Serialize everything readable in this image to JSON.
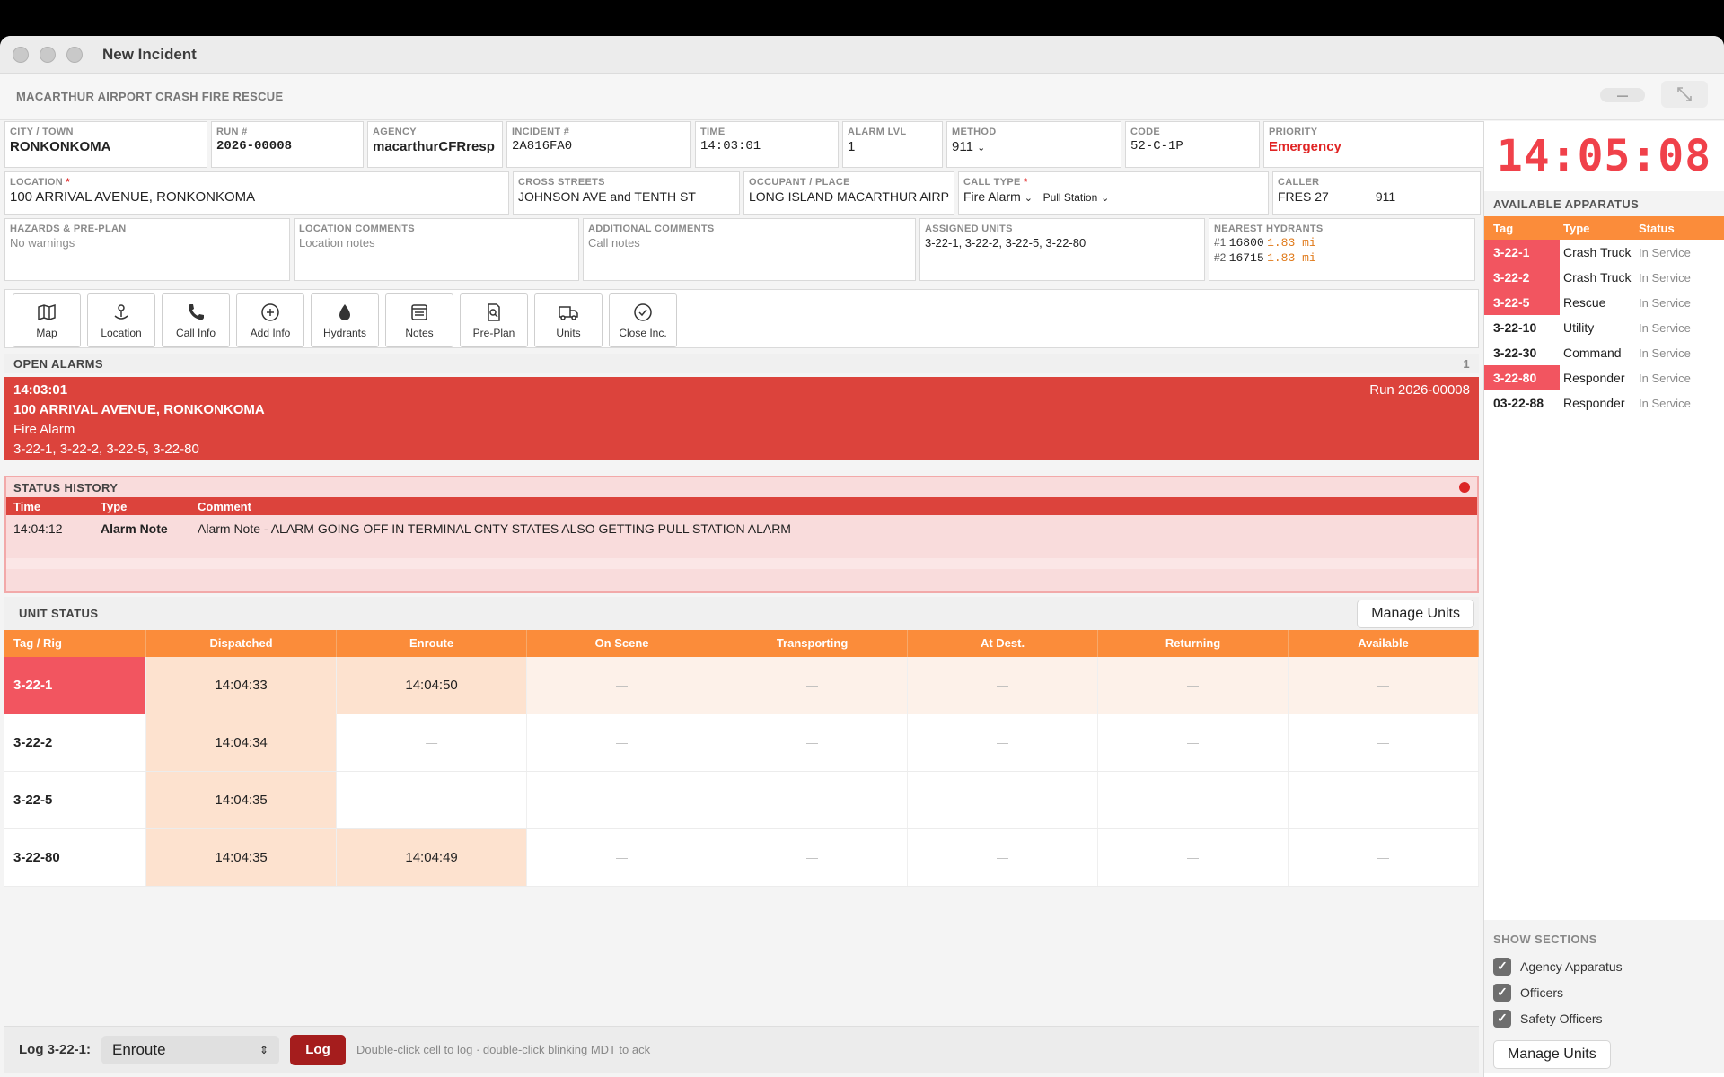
{
  "window": {
    "title": "New Incident"
  },
  "agency_bar": {
    "name": "MACARTHUR AIRPORT CRASH FIRE RESCUE",
    "min_label": "—"
  },
  "fields": {
    "city": {
      "label": "CITY / TOWN",
      "value": "RONKONKOMA"
    },
    "run": {
      "label": "RUN #",
      "value": "2026-00008"
    },
    "agency": {
      "label": "AGENCY",
      "value": "macarthurCFRresp"
    },
    "incident": {
      "label": "INCIDENT #",
      "value": "2A816FA0"
    },
    "time": {
      "label": "TIME",
      "value": "14:03:01"
    },
    "alarm_lvl": {
      "label": "ALARM LVL",
      "value": "1"
    },
    "method": {
      "label": "METHOD",
      "value": "911"
    },
    "code": {
      "label": "CODE",
      "value": "52-C-1P"
    },
    "priority": {
      "label": "PRIORITY",
      "value": "Emergency"
    },
    "location": {
      "label": "LOCATION",
      "value": "100 ARRIVAL AVENUE, RONKONKOMA"
    },
    "cross_streets": {
      "label": "CROSS STREETS",
      "value": "JOHNSON AVE and TENTH ST"
    },
    "occupant": {
      "label": "OCCUPANT / PLACE",
      "value": "LONG ISLAND MACARTHUR AIRPORT"
    },
    "call_type": {
      "label": "CALL TYPE",
      "value": "Fire Alarm",
      "subtype": "Pull Station"
    },
    "caller": {
      "label": "CALLER",
      "value": "FRES 27",
      "number": "911"
    },
    "hazards": {
      "label": "HAZARDS & PRE-PLAN",
      "value": "No warnings"
    },
    "location_comments": {
      "label": "LOCATION COMMENTS",
      "placeholder": "Location notes"
    },
    "additional_comments": {
      "label": "ADDITIONAL COMMENTS",
      "placeholder": "Call notes"
    },
    "assigned_units": {
      "label": "ASSIGNED UNITS",
      "value": "3-22-1, 3-22-2, 3-22-5, 3-22-80"
    },
    "nearest_hydrants": {
      "label": "NEAREST HYDRANTS",
      "items": [
        {
          "rank": "#1",
          "id": "16800",
          "dist": "1.83 mi"
        },
        {
          "rank": "#2",
          "id": "16715",
          "dist": "1.83 mi"
        }
      ]
    }
  },
  "toolbar": [
    {
      "label": "Map",
      "icon": "map-icon"
    },
    {
      "label": "Location",
      "icon": "location-pin-icon"
    },
    {
      "label": "Call Info",
      "icon": "phone-icon"
    },
    {
      "label": "Add Info",
      "icon": "plus-circle-icon"
    },
    {
      "label": "Hydrants",
      "icon": "drop-icon"
    },
    {
      "label": "Notes",
      "icon": "notes-icon"
    },
    {
      "label": "Pre-Plan",
      "icon": "document-search-icon"
    },
    {
      "label": "Units",
      "icon": "truck-icon"
    },
    {
      "label": "Close Inc.",
      "icon": "check-circle-icon"
    }
  ],
  "open_alarms": {
    "title": "OPEN ALARMS",
    "count": "1",
    "alarm": {
      "time": "14:03:01",
      "address": "100 ARRIVAL AVENUE, RONKONKOMA",
      "type": "Fire Alarm",
      "units": "3-22-1, 3-22-2, 3-22-5, 3-22-80",
      "run": "Run 2026-00008"
    }
  },
  "status_history": {
    "title": "STATUS HISTORY",
    "columns": [
      "Time",
      "Type",
      "Comment"
    ],
    "rows": [
      {
        "time": "14:04:12",
        "type": "Alarm Note",
        "comment": "Alarm Note - ALARM GOING OFF IN TERMINAL CNTY STATES ALSO GETTING PULL STATION ALARM"
      }
    ]
  },
  "unit_status": {
    "title": "UNIT STATUS",
    "manage_label": "Manage Units",
    "columns": [
      "Tag / Rig",
      "Dispatched",
      "Enroute",
      "On Scene",
      "Transporting",
      "At Dest.",
      "Returning",
      "Available"
    ],
    "empty": "—",
    "rows": [
      {
        "tag": "3-22-1",
        "selected": true,
        "cells": [
          "14:04:33",
          "14:04:50",
          "",
          "",
          "",
          "",
          ""
        ]
      },
      {
        "tag": "3-22-2",
        "selected": false,
        "cells": [
          "14:04:34",
          "",
          "",
          "",
          "",
          "",
          ""
        ]
      },
      {
        "tag": "3-22-5",
        "selected": false,
        "cells": [
          "14:04:35",
          "",
          "",
          "",
          "",
          "",
          ""
        ]
      },
      {
        "tag": "3-22-80",
        "selected": false,
        "cells": [
          "14:04:35",
          "14:04:49",
          "",
          "",
          "",
          "",
          ""
        ]
      }
    ]
  },
  "footer": {
    "log_label": "Log 3-22-1:",
    "select_value": "Enroute",
    "log_button": "Log",
    "hint": "Double-click cell to log · double-click blinking MDT to ack"
  },
  "clock": "14:05:08",
  "apparatus": {
    "title": "AVAILABLE APPARATUS",
    "columns": [
      "Tag",
      "Type",
      "Status"
    ],
    "rows": [
      {
        "tag": "3-22-1",
        "type": "Crash Truck",
        "status": "In Service",
        "assigned": true
      },
      {
        "tag": "3-22-2",
        "type": "Crash Truck",
        "status": "In Service",
        "assigned": true
      },
      {
        "tag": "3-22-5",
        "type": "Rescue",
        "status": "In Service",
        "assigned": true
      },
      {
        "tag": "3-22-10",
        "type": "Utility",
        "status": "In Service",
        "assigned": false
      },
      {
        "tag": "3-22-30",
        "type": "Command",
        "status": "In Service",
        "assigned": false
      },
      {
        "tag": "3-22-80",
        "type": "Responder",
        "status": "In Service",
        "assigned": true
      },
      {
        "tag": "03-22-88",
        "type": "Responder",
        "status": "In Service",
        "assigned": false
      }
    ]
  },
  "show_sections": {
    "title": "SHOW SECTIONS",
    "items": [
      {
        "label": "Agency Apparatus",
        "checked": true
      },
      {
        "label": "Officers",
        "checked": true
      },
      {
        "label": "Safety Officers",
        "checked": true
      }
    ],
    "manage_label": "Manage Units"
  },
  "colors": {
    "accent_orange": "#fb8c3a",
    "alarm_red": "#dc433c",
    "tag_red": "#f25560",
    "clock_red": "#f0414a"
  }
}
